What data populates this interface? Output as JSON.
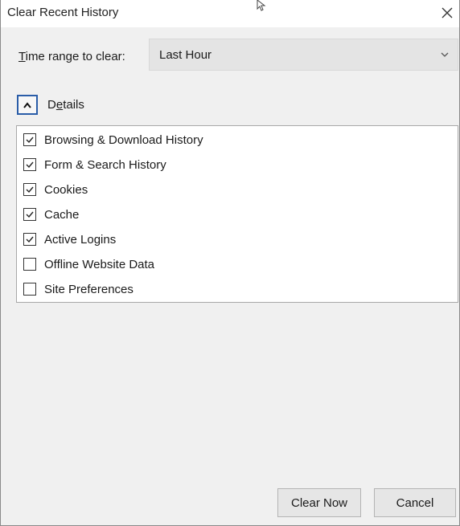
{
  "window": {
    "title": "Clear Recent History"
  },
  "time_range": {
    "label_first": "T",
    "label_rest": "ime range to clear:",
    "selected": "Last Hour"
  },
  "details": {
    "label_first": "D",
    "label_underlined": "e",
    "label_rest": "tails",
    "expanded": true
  },
  "items": [
    {
      "label": "Browsing & Download History",
      "checked": true
    },
    {
      "label": "Form & Search History",
      "checked": true
    },
    {
      "label": "Cookies",
      "checked": true
    },
    {
      "label": "Cache",
      "checked": true
    },
    {
      "label": "Active Logins",
      "checked": true
    },
    {
      "label": "Offline Website Data",
      "checked": false
    },
    {
      "label": "Site Preferences",
      "checked": false
    }
  ],
  "buttons": {
    "clear_now": "Clear Now",
    "cancel": "Cancel"
  }
}
